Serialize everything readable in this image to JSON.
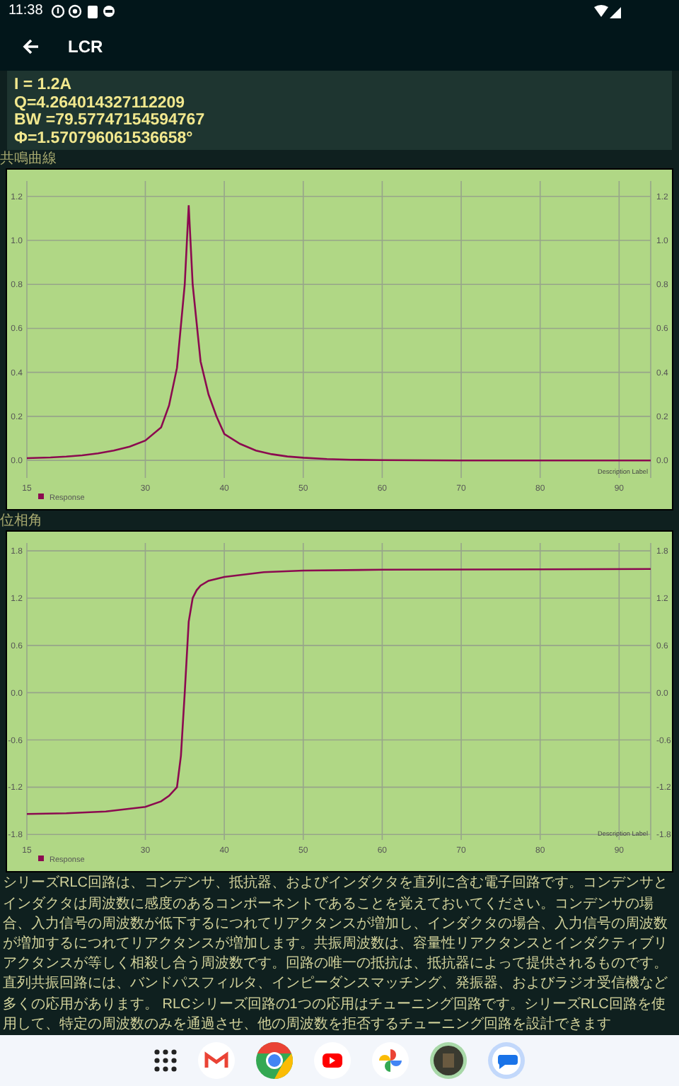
{
  "status_bar": {
    "time": "11:38"
  },
  "app_bar": {
    "title": "LCR"
  },
  "results": {
    "lines": [
      "I = 1.2A",
      "Q=4.264014327112209",
      "BW =79.57747154594767",
      "Φ=1.570796061536658°"
    ]
  },
  "charts": [
    {
      "label": "共鳴曲線",
      "chart_data": {
        "type": "line",
        "grid": true,
        "x": [
          15,
          18,
          20,
          22,
          24,
          26,
          28,
          30,
          32,
          33,
          34,
          35,
          35.5,
          36,
          37,
          38,
          39,
          40,
          42,
          44,
          46,
          48,
          50,
          53,
          56,
          60,
          70,
          80,
          94
        ],
        "series": [
          {
            "name": "Response",
            "color": "#8b0a50",
            "values": [
              0.01,
              0.013,
              0.017,
              0.023,
              0.032,
              0.045,
              0.062,
              0.09,
              0.15,
              0.25,
              0.42,
              0.8,
              1.16,
              0.8,
              0.45,
              0.3,
              0.2,
              0.12,
              0.075,
              0.045,
              0.028,
              0.018,
              0.012,
              0.006,
              0.003,
              0.001,
              0.0,
              0.0,
              0.0
            ]
          }
        ],
        "xlim": [
          15,
          94
        ],
        "ylim": [
          -0.08,
          1.27
        ],
        "xticks": [
          15,
          30,
          40,
          50,
          60,
          70,
          80,
          90
        ],
        "yticks": [
          {
            "value": 0,
            "label": "0.0"
          },
          {
            "value": 0.2,
            "label": "0.2"
          },
          {
            "value": 0.4,
            "label": "0.4"
          },
          {
            "value": 0.6,
            "label": "0.6"
          },
          {
            "value": 0.8,
            "label": "0.8"
          },
          {
            "value": 1,
            "label": "1.0"
          },
          {
            "value": 1.2,
            "label": "1.2"
          }
        ],
        "annotations": [
          "Description Label"
        ]
      }
    },
    {
      "label": "位相角",
      "chart_data": {
        "type": "line",
        "grid": true,
        "x": [
          15,
          20,
          25,
          30,
          32,
          33,
          34,
          34.5,
          35,
          35.5,
          36,
          36.5,
          37,
          38,
          40,
          45,
          50,
          60,
          94
        ],
        "series": [
          {
            "name": "Response",
            "color": "#8b0a50",
            "values": [
              -1.54,
              -1.53,
              -1.51,
              -1.45,
              -1.38,
              -1.31,
              -1.2,
              -0.8,
              0.0,
              0.9,
              1.2,
              1.3,
              1.36,
              1.42,
              1.47,
              1.53,
              1.55,
              1.56,
              1.57
            ]
          }
        ],
        "xlim": [
          15,
          94
        ],
        "ylim": [
          -1.87,
          1.9
        ],
        "xticks": [
          15,
          30,
          40,
          50,
          60,
          70,
          80,
          90
        ],
        "yticks": [
          {
            "value": -1.8,
            "label": "-1.8"
          },
          {
            "value": -1.2,
            "label": "-1.2"
          },
          {
            "value": -0.6,
            "label": "-0.6"
          },
          {
            "value": 0,
            "label": "0.0"
          },
          {
            "value": 0.6,
            "label": "0.6"
          },
          {
            "value": 1.2,
            "label": "1.2"
          },
          {
            "value": 1.8,
            "label": "1.8"
          }
        ],
        "annotations": [
          "Description Label"
        ]
      }
    }
  ],
  "description": {
    "paragraphs": [
      "シリーズRLC回路は、コンデンサ、抵抗器、およびインダクタを直列に含む電子回路です。コンデンサとインダクタは周波数に感度のあるコンポーネントであることを覚えておいてください。コンデンサの場合、入力信号の周波数が低下するにつれてリアクタンスが増加し、インダクタの場合、入力信号の周波数が増加するにつれてリアクタンスが増加します。共振周波数は、容量性リアクタンスとインダクティブリアクタンスが等しく相殺し合う周波数です。回路の唯一の抵抗は、抵抗器によって提供されるものです。",
      "直列共振回路には、バンドパスフィルタ、インピーダンスマッチング、発振器、およびラジオ受信機など多くの応用があります。 RLCシリーズ回路の1つの応用はチューニング回路です。シリーズRLC回路を使用して、特定の周波数のみを通過させ、他の周波数を拒否するチューニング回路を設計できます"
    ]
  }
}
